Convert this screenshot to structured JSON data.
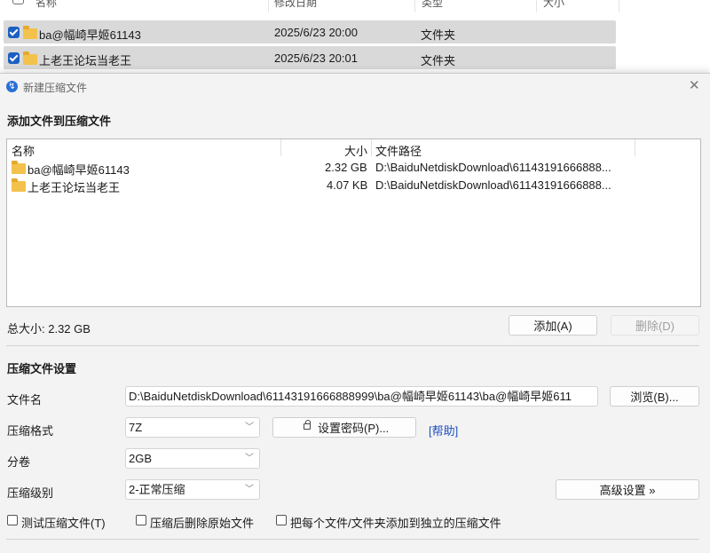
{
  "explorer": {
    "columns": [
      "名称",
      "修改日期",
      "类型",
      "大小"
    ],
    "rows": [
      {
        "name": "ba@幅崎早姬61143",
        "date": "2025/6/23 20:00",
        "type": "文件夹"
      },
      {
        "name": "上老王论坛当老王",
        "date": "2025/6/23 20:01",
        "type": "文件夹"
      }
    ]
  },
  "dialog": {
    "title": "新建压缩文件",
    "close_glyph": "✕",
    "add_section_title": "添加文件到压缩文件",
    "file_list": {
      "columns": {
        "name": "名称",
        "size": "大小",
        "path": "文件路径"
      },
      "rows": [
        {
          "name": "ba@幅崎早姬61143",
          "size": "2.32 GB",
          "path": "D:\\BaiduNetdiskDownload\\61143191666888..."
        },
        {
          "name": "上老王论坛当老王",
          "size": "4.07 KB",
          "path": "D:\\BaiduNetdiskDownload\\61143191666888..."
        }
      ]
    },
    "total_size": "总大小: 2.32 GB",
    "add_button": "添加(A)",
    "delete_button": "删除(D)",
    "settings_title": "压缩文件设置",
    "filename_label": "文件名",
    "filename_value": "D:\\BaiduNetdiskDownload\\61143191666888999\\ba@幅崎早姬61143\\ba@幅崎早姬611",
    "browse_button": "浏览(B)...",
    "format_label": "压缩格式",
    "format_value": "7Z",
    "password_button": "设置密码(P)...",
    "help_link": "[帮助]",
    "split_label": "分卷",
    "split_value": "2GB",
    "level_label": "压缩级别",
    "level_value": "2-正常压缩",
    "advanced_button": "高级设置 »",
    "options": {
      "test": "测试压缩文件(T)",
      "delete_after": "压缩后删除原始文件",
      "each_separate": "把每个文件/文件夹添加到独立的压缩文件"
    }
  }
}
